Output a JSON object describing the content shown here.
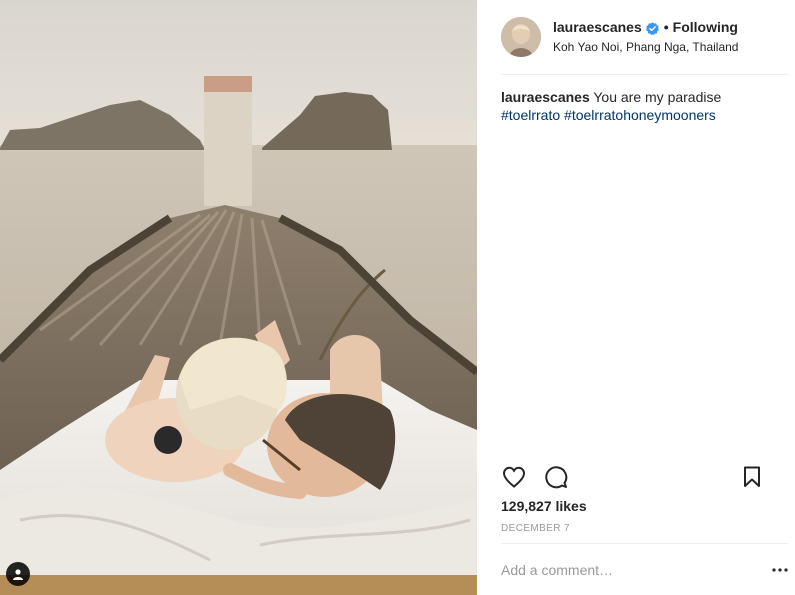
{
  "post": {
    "username": "lauraescanes",
    "follow_separator": "•",
    "follow_status": "Following",
    "location": "Koh Yao Noi, Phang Nga, Thailand",
    "caption": {
      "username": "lauraescanes",
      "text": "You are my paradise",
      "hashtags": [
        "#toelrrato",
        "#toelrratohoneymooners"
      ]
    },
    "likes": "129,827 likes",
    "date": "DECEMBER 7",
    "comment_placeholder": "Add a comment…"
  },
  "icons": {
    "verified": "verified-badge-icon",
    "like": "heart-icon",
    "comment": "comment-bubble-icon",
    "save": "bookmark-icon",
    "more": "more-options-icon",
    "tags": "user-tag-icon"
  },
  "colors": {
    "text": "#262626",
    "hashtag": "#003569",
    "muted": "#999999",
    "verified": "#3897f0",
    "divider": "#efefef"
  }
}
